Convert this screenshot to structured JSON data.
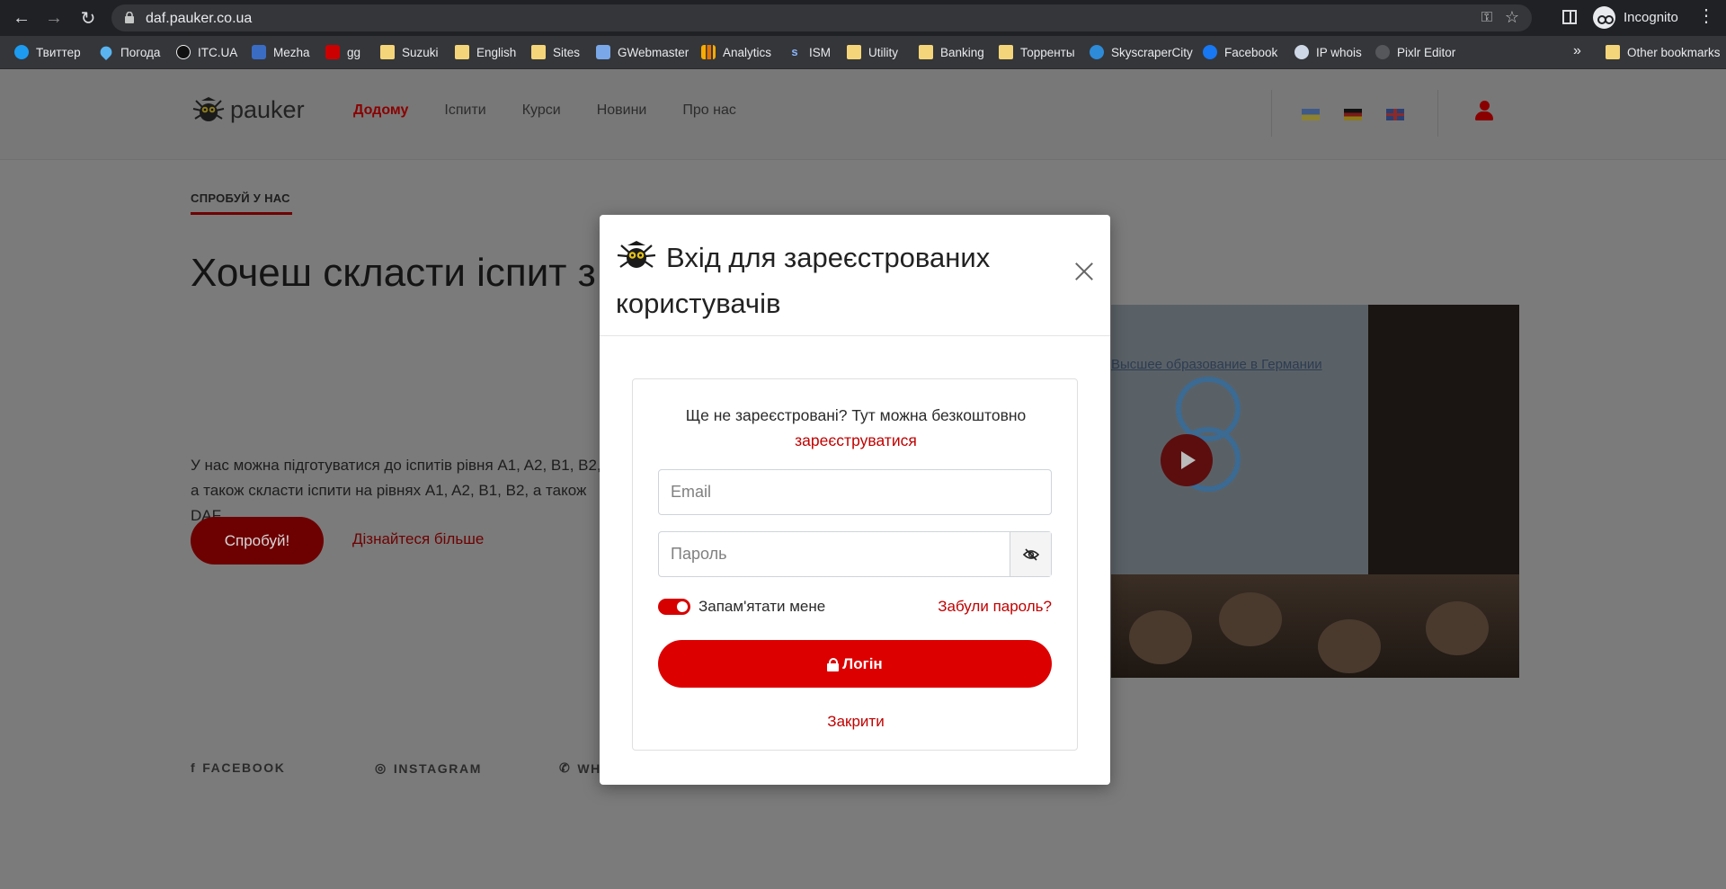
{
  "browser": {
    "url": "daf.pauker.co.ua",
    "profile_label": "Incognito",
    "bookmarks": [
      {
        "label": "Твиттер",
        "icon": "twitter-icon"
      },
      {
        "label": "Погода",
        "icon": "weather-drop-icon"
      },
      {
        "label": "ITC.UA",
        "icon": "itc-icon"
      },
      {
        "label": "Mezha",
        "icon": "mezha-icon"
      },
      {
        "label": "gg",
        "icon": "gg-icon"
      },
      {
        "label": "Suzuki",
        "icon": "folder-icon"
      },
      {
        "label": "English",
        "icon": "folder-icon"
      },
      {
        "label": "Sites",
        "icon": "folder-icon"
      },
      {
        "label": "GWebmaster",
        "icon": "gwebmaster-icon"
      },
      {
        "label": "Analytics",
        "icon": "analytics-icon"
      },
      {
        "label": "ISM",
        "icon": "ism-icon"
      },
      {
        "label": "Utility",
        "icon": "folder-icon"
      },
      {
        "label": "Banking",
        "icon": "folder-icon"
      },
      {
        "label": "Торренты",
        "icon": "folder-icon"
      },
      {
        "label": "SkyscraperCity",
        "icon": "skyscrapercity-icon"
      },
      {
        "label": "Facebook",
        "icon": "facebook-icon"
      },
      {
        "label": "IP whois",
        "icon": "magnifier-icon"
      },
      {
        "label": "Pixlr Editor",
        "icon": "pixlr-icon"
      }
    ],
    "more_chevron": "»",
    "other_bookmarks": "Other bookmarks"
  },
  "site": {
    "logo_text": "pauker",
    "nav": [
      "Додому",
      "Іспити",
      "Курси",
      "Новини",
      "Про нас"
    ],
    "active_nav": "Додому",
    "languages": [
      "uk",
      "de",
      "en"
    ],
    "accent_color": "#dd0000"
  },
  "hero": {
    "eyebrow": "СПРОБУЙ У НАС",
    "title": "Хочеш скласти іспит з німецької?",
    "text": "У нас можна підготуватися до іспитів рівня A1, A2, B1, B2, а також скласти іспити на рівнях A1, A2, B1, B2, а також DAF.",
    "try_button": "Спробуй!",
    "learn_more": "Дізнайтеся більше",
    "video_caption": "Высшее образование в Германии"
  },
  "social": {
    "facebook": "FACEBOOK",
    "instagram": "INSTAGRAM",
    "whatsapp": "WHATSAPP"
  },
  "modal": {
    "title": "Вхід для зареєстрованих користувачів",
    "not_registered": "Ще не зареєстровані? Тут можна безкоштовно",
    "register_link": "зареєструватися",
    "email_placeholder": "Email",
    "password_placeholder": "Пароль",
    "remember_me": "Запам'ятати мене",
    "remember_checked": true,
    "forgot_password": "Забули пароль?",
    "login_button": "Логін",
    "close_link": "Закрити"
  }
}
